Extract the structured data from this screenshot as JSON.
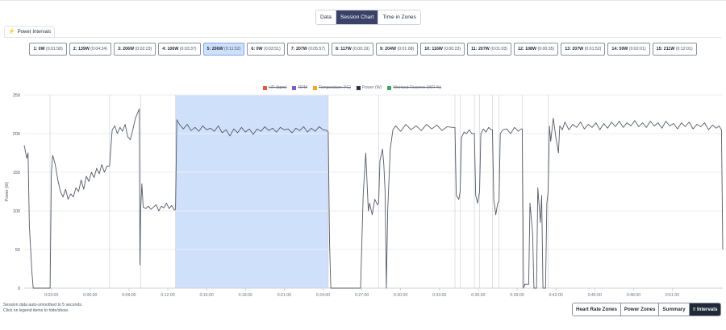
{
  "view_toggle": {
    "items": [
      "Data",
      "Session Chart",
      "Time in Zones"
    ],
    "active": "Session Chart"
  },
  "tab": {
    "label": "Power Intervals"
  },
  "intervals": [
    {
      "label": "1: 0W",
      "time": "(0:01:58)"
    },
    {
      "label": "2: 139W",
      "time": "(0:04:34)"
    },
    {
      "label": "3: 206W",
      "time": "(0:02:23)"
    },
    {
      "label": "4: 106W",
      "time": "(0:03:37)"
    },
    {
      "label": "5: 206W",
      "time": "(0:11:52)",
      "selected": true
    },
    {
      "label": "6: 0W",
      "time": "(0:03:51)"
    },
    {
      "label": "7: 207W",
      "time": "(0:05:57)"
    },
    {
      "label": "8: 117W",
      "time": "(0:00:19)"
    },
    {
      "label": "9: 204W",
      "time": "(0:01:08)"
    },
    {
      "label": "10: 116W",
      "time": "(0:00:23)"
    },
    {
      "label": "11: 207W",
      "time": "(0:01:03)"
    },
    {
      "label": "12: 108W",
      "time": "(0:00:35)"
    },
    {
      "label": "13: 207W",
      "time": "(0:01:52)"
    },
    {
      "label": "14: 59W",
      "time": "(0:02:01)"
    },
    {
      "label": "15: 211W",
      "time": "(0:12:01)"
    }
  ],
  "legend": [
    {
      "label": "HR (bpm)",
      "color": "#e05a47",
      "hidden": true
    },
    {
      "label": "RPM",
      "color": "#7c5cd6",
      "hidden": true
    },
    {
      "label": "Temperature (°C)",
      "color": "#f5a623",
      "hidden": true
    },
    {
      "label": "Power (W)",
      "color": "#2b2f45",
      "hidden": false
    },
    {
      "label": "Workout Reserve (WR %)",
      "color": "#3aa65a",
      "hidden": true
    }
  ],
  "chart_data": {
    "type": "line",
    "ylabel": "Power (W)",
    "ylim": [
      0,
      250
    ],
    "yticks": [
      0,
      50,
      100,
      150,
      200,
      250
    ],
    "xlabel": "",
    "xlim_min": [
      0.9,
      54.9
    ],
    "xticks": [
      "0:03:00",
      "0:06:00",
      "0:09:00",
      "0:12:00",
      "0:15:00",
      "0:18:00",
      "0:21:00",
      "0:24:00",
      "0:27:00",
      "0:30:00",
      "0:33:00",
      "0:36:00",
      "0:39:00",
      "0:42:00",
      "0:45:00",
      "0:48:00",
      "0:51:00"
    ],
    "xtick_minutes": [
      3,
      6,
      9,
      12,
      15,
      18,
      21,
      24,
      27,
      30,
      33,
      36,
      39,
      42,
      45,
      48,
      51
    ],
    "highlight_min": [
      12.6,
      24.4
    ],
    "interval_boundaries_min": [
      2.9,
      7.5,
      9.9,
      12.6,
      24.4,
      28.3,
      34.2,
      34.6,
      35.7,
      36.1,
      37.1,
      37.6,
      39.4,
      41.4
    ],
    "series": [
      {
        "name": "Power (W)",
        "color": "#555a66",
        "points": [
          [
            0.9,
            185
          ],
          [
            1.1,
            168
          ],
          [
            1.2,
            175
          ],
          [
            1.3,
            80
          ],
          [
            1.5,
            20
          ],
          [
            1.6,
            0
          ],
          [
            2.9,
            0
          ],
          [
            3.0,
            150
          ],
          [
            3.1,
            172
          ],
          [
            3.3,
            160
          ],
          [
            3.5,
            140
          ],
          [
            3.7,
            125
          ],
          [
            3.9,
            118
          ],
          [
            4.1,
            128
          ],
          [
            4.3,
            115
          ],
          [
            4.5,
            122
          ],
          [
            4.7,
            118
          ],
          [
            4.9,
            130
          ],
          [
            5.1,
            125
          ],
          [
            5.3,
            140
          ],
          [
            5.5,
            128
          ],
          [
            5.7,
            145
          ],
          [
            5.9,
            138
          ],
          [
            6.1,
            150
          ],
          [
            6.3,
            143
          ],
          [
            6.5,
            155
          ],
          [
            6.7,
            148
          ],
          [
            6.9,
            160
          ],
          [
            7.1,
            150
          ],
          [
            7.3,
            158
          ],
          [
            7.5,
            158
          ],
          [
            7.7,
            205
          ],
          [
            7.9,
            210
          ],
          [
            8.1,
            200
          ],
          [
            8.3,
            208
          ],
          [
            8.5,
            203
          ],
          [
            8.7,
            212
          ],
          [
            8.9,
            196
          ],
          [
            9.1,
            192
          ],
          [
            9.3,
            205
          ],
          [
            9.5,
            220
          ],
          [
            9.7,
            228
          ],
          [
            9.8,
            232
          ],
          [
            9.85,
            30
          ],
          [
            9.9,
            100
          ],
          [
            10.0,
            135
          ],
          [
            10.1,
            105
          ],
          [
            10.3,
            103
          ],
          [
            10.5,
            106
          ],
          [
            10.7,
            102
          ],
          [
            10.9,
            105
          ],
          [
            11.1,
            108
          ],
          [
            11.3,
            100
          ],
          [
            11.5,
            106
          ],
          [
            11.7,
            104
          ],
          [
            11.9,
            110
          ],
          [
            12.1,
            103
          ],
          [
            12.3,
            107
          ],
          [
            12.5,
            101
          ],
          [
            12.6,
            102
          ],
          [
            12.7,
            218
          ],
          [
            12.9,
            212
          ],
          [
            13.2,
            206
          ],
          [
            13.5,
            212
          ],
          [
            13.8,
            204
          ],
          [
            14.1,
            208
          ],
          [
            14.4,
            203
          ],
          [
            14.7,
            210
          ],
          [
            15.0,
            205
          ],
          [
            15.3,
            207
          ],
          [
            15.6,
            203
          ],
          [
            15.9,
            210
          ],
          [
            16.2,
            201
          ],
          [
            16.5,
            205
          ],
          [
            16.8,
            197
          ],
          [
            17.1,
            206
          ],
          [
            17.4,
            201
          ],
          [
            17.7,
            208
          ],
          [
            18.0,
            202
          ],
          [
            18.3,
            206
          ],
          [
            18.6,
            199
          ],
          [
            18.9,
            206
          ],
          [
            19.2,
            203
          ],
          [
            19.5,
            209
          ],
          [
            19.8,
            204
          ],
          [
            20.1,
            207
          ],
          [
            20.4,
            202
          ],
          [
            20.7,
            208
          ],
          [
            21.0,
            205
          ],
          [
            21.3,
            206
          ],
          [
            21.6,
            201
          ],
          [
            21.9,
            207
          ],
          [
            22.2,
            204
          ],
          [
            22.5,
            209
          ],
          [
            22.8,
            202
          ],
          [
            23.1,
            207
          ],
          [
            23.4,
            203
          ],
          [
            23.7,
            209
          ],
          [
            24.0,
            205
          ],
          [
            24.3,
            204
          ],
          [
            24.4,
            202
          ],
          [
            24.5,
            60
          ],
          [
            24.6,
            0
          ],
          [
            26.9,
            0
          ],
          [
            27.1,
            120
          ],
          [
            27.3,
            175
          ],
          [
            27.5,
            100
          ],
          [
            27.6,
            110
          ],
          [
            27.8,
            95
          ],
          [
            28.0,
            115
          ],
          [
            28.2,
            108
          ],
          [
            28.3,
            110
          ],
          [
            28.4,
            165
          ],
          [
            28.6,
            180
          ],
          [
            28.7,
            160
          ],
          [
            28.8,
            125
          ],
          [
            28.9,
            0
          ],
          [
            29.0,
            100
          ],
          [
            29.2,
            180
          ],
          [
            29.4,
            205
          ],
          [
            29.6,
            210
          ],
          [
            30.0,
            203
          ],
          [
            30.4,
            212
          ],
          [
            30.8,
            205
          ],
          [
            31.2,
            210
          ],
          [
            31.6,
            204
          ],
          [
            32.0,
            212
          ],
          [
            32.4,
            206
          ],
          [
            32.8,
            211
          ],
          [
            33.2,
            204
          ],
          [
            33.6,
            209
          ],
          [
            34.0,
            208
          ],
          [
            34.2,
            208
          ],
          [
            34.3,
            120
          ],
          [
            34.5,
            115
          ],
          [
            34.6,
            125
          ],
          [
            34.7,
            195
          ],
          [
            34.9,
            202
          ],
          [
            35.1,
            200
          ],
          [
            35.3,
            205
          ],
          [
            35.5,
            200
          ],
          [
            35.7,
            200
          ],
          [
            35.8,
            120
          ],
          [
            35.95,
            110
          ],
          [
            36.1,
            125
          ],
          [
            36.2,
            200
          ],
          [
            36.4,
            206
          ],
          [
            36.6,
            202
          ],
          [
            36.8,
            208
          ],
          [
            37.0,
            205
          ],
          [
            37.1,
            205
          ],
          [
            37.2,
            115
          ],
          [
            37.35,
            95
          ],
          [
            37.5,
            110
          ],
          [
            37.6,
            112
          ],
          [
            37.7,
            200
          ],
          [
            37.9,
            205
          ],
          [
            38.2,
            206
          ],
          [
            38.5,
            200
          ],
          [
            38.8,
            208
          ],
          [
            39.1,
            203
          ],
          [
            39.3,
            206
          ],
          [
            39.4,
            206
          ],
          [
            39.5,
            0
          ],
          [
            39.6,
            5
          ],
          [
            39.9,
            5
          ],
          [
            40.0,
            110
          ],
          [
            40.2,
            70
          ],
          [
            40.3,
            0
          ],
          [
            40.5,
            0
          ],
          [
            40.6,
            130
          ],
          [
            40.8,
            85
          ],
          [
            40.9,
            120
          ],
          [
            41.0,
            0
          ],
          [
            41.2,
            0
          ],
          [
            41.3,
            110
          ],
          [
            41.4,
            125
          ],
          [
            41.5,
            210
          ],
          [
            41.6,
            190
          ],
          [
            41.8,
            220
          ],
          [
            42.0,
            195
          ],
          [
            42.2,
            175
          ],
          [
            42.3,
            210
          ],
          [
            42.5,
            205
          ],
          [
            42.7,
            215
          ],
          [
            43.0,
            205
          ],
          [
            43.3,
            212
          ],
          [
            43.6,
            208
          ],
          [
            43.9,
            215
          ],
          [
            44.2,
            206
          ],
          [
            44.5,
            212
          ],
          [
            44.8,
            208
          ],
          [
            45.1,
            214
          ],
          [
            45.4,
            205
          ],
          [
            45.7,
            213
          ],
          [
            46.0,
            207
          ],
          [
            46.3,
            215
          ],
          [
            46.6,
            209
          ],
          [
            46.9,
            216
          ],
          [
            47.2,
            208
          ],
          [
            47.5,
            214
          ],
          [
            47.8,
            210
          ],
          [
            48.1,
            217
          ],
          [
            48.4,
            209
          ],
          [
            48.7,
            214
          ],
          [
            49.0,
            208
          ],
          [
            49.3,
            216
          ],
          [
            49.6,
            210
          ],
          [
            49.9,
            214
          ],
          [
            50.2,
            207
          ],
          [
            50.5,
            216
          ],
          [
            50.8,
            210
          ],
          [
            51.1,
            213
          ],
          [
            51.4,
            206
          ],
          [
            51.7,
            214
          ],
          [
            52.0,
            209
          ],
          [
            52.3,
            215
          ],
          [
            52.6,
            206
          ],
          [
            52.9,
            212
          ],
          [
            53.2,
            209
          ],
          [
            53.5,
            214
          ],
          [
            53.8,
            205
          ],
          [
            54.1,
            211
          ],
          [
            54.4,
            207
          ],
          [
            54.6,
            210
          ],
          [
            54.8,
            205
          ],
          [
            54.9,
            50
          ]
        ]
      }
    ]
  },
  "footer_note": {
    "line1": "Session data auto-smoothed to 5 seconds.",
    "line2": "Click on legend items to hide/show."
  },
  "bottom_tabs": {
    "items": [
      "Heart Rate Zones",
      "Power Zones",
      "Summary",
      "≡ Intervals"
    ],
    "active": "≡ Intervals"
  }
}
